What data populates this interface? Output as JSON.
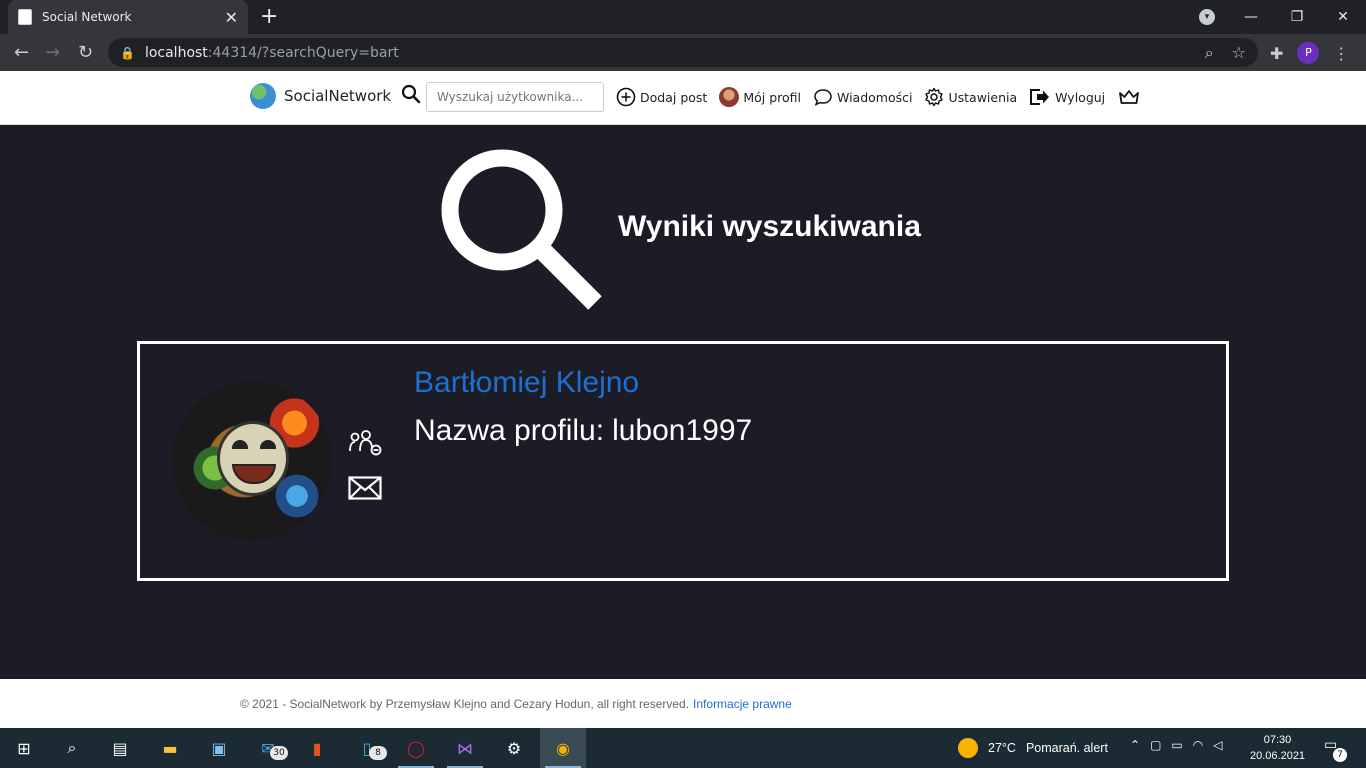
{
  "browser": {
    "tab_title": "Social Network",
    "url_host": "localhost",
    "url_rest": ":44314/?searchQuery=bart",
    "profile_initial": "P"
  },
  "header": {
    "brand": "SocialNetwork",
    "search_placeholder": "Wyszukaj użytkownika...",
    "nav": {
      "add_post": "Dodaj post",
      "my_profile": "Mój profil",
      "messages": "Wiadomości",
      "settings": "Ustawienia",
      "logout": "Wyloguj"
    }
  },
  "main": {
    "title": "Wyniki wyszukiwania",
    "results": [
      {
        "name": "Bartłomiej Klejno",
        "profile_label": "Nazwa profilu:",
        "profile_name": "lubon1997"
      }
    ]
  },
  "footer": {
    "text": "© 2021 - SocialNetwork by Przemysław Klejno and Cezary Hodun, all right reserved.",
    "link": "Informacje prawne"
  },
  "taskbar": {
    "mail_badge": "30",
    "phone_badge": "8",
    "weather_temp": "27°C",
    "weather_alert": "Pomarań. alert",
    "time": "07:30",
    "date": "20.06.2021",
    "notifications": "7"
  },
  "colors": {
    "page_bg": "#1c1c26",
    "link_blue": "#1f6fd1"
  }
}
